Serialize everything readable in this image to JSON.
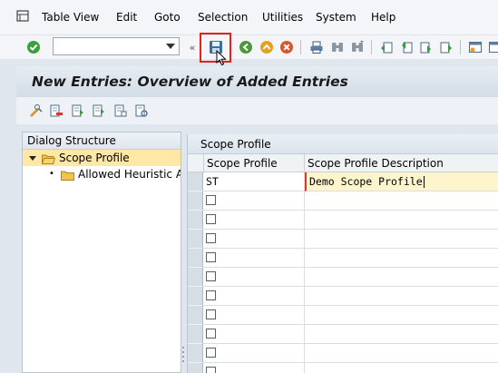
{
  "menubar": {
    "items": [
      "Table View",
      "Edit",
      "Goto",
      "Selection",
      "Utilities",
      "System",
      "Help"
    ]
  },
  "toolbar": {
    "command_field_value": "",
    "icons": [
      "enter-icon",
      "save-icon",
      "back-icon",
      "exit-icon",
      "cancel-icon",
      "print-icon",
      "find-icon",
      "find-next-icon",
      "first-page-icon",
      "previous-page-icon",
      "next-page-icon",
      "last-page-icon",
      "create-session-icon"
    ]
  },
  "title": "New Entries: Overview of Added Entries",
  "app_toolbar": {
    "icons": [
      "change-display-icon",
      "delete-icon",
      "select-all-icon",
      "select-block-icon",
      "deselect-all-icon",
      "configuration-icon"
    ]
  },
  "dialog_structure": {
    "header": "Dialog Structure",
    "items": [
      {
        "label": "Scope Profile",
        "selected": true,
        "expanded": true
      },
      {
        "label": "Allowed Heuristic Alg",
        "selected": false
      }
    ]
  },
  "table": {
    "title": "Scope Profile",
    "columns": [
      "Scope Profile",
      "Scope Profile Description"
    ],
    "rows": [
      {
        "scope_profile": "ST",
        "description": "Demo Scope Profile"
      }
    ],
    "empty_rows": 10
  },
  "colors": {
    "highlight": "#e0241b",
    "selected_row": "#ffe7a6",
    "active_input": "#fff5cc"
  }
}
